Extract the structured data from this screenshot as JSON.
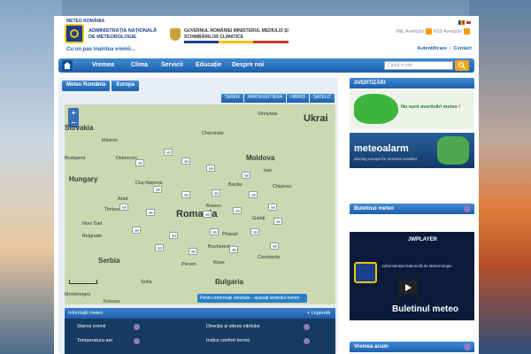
{
  "header": {
    "logo_small": "METEO ROMÂNIA",
    "anm_name": "ADMINISTRAȚIA NAȚIONALĂ DE METEOROLOGIE",
    "slogan": "Cu un pas înaintea vremii...",
    "gov_name": "GUVERNUL ROMÂNIEI MINISTERUL MEDIULUI ȘI SCHIMBĂRILOR CLIMATICE",
    "feeds": {
      "xml": "XML Avertizări",
      "rss": "RSS Avertizări"
    },
    "links": {
      "auth": "Autentificare",
      "contact": "Contact"
    }
  },
  "nav": {
    "items": [
      "Vremea",
      "Clima",
      "Servicii",
      "Educație",
      "Despre noi"
    ],
    "search_placeholder": "Caută in site"
  },
  "map": {
    "tabs": [
      "Meteo România",
      "Europa"
    ],
    "types": [
      "TEREN",
      "HARTA RUTIERA",
      "HIBRID",
      "SATELIT"
    ],
    "labels": {
      "ukraine": "Ukrai",
      "slovakia": "Slovakia",
      "hungary": "Hungary",
      "moldova": "Moldova",
      "serbia": "Serbia",
      "romania": "Romania",
      "vinnytsia": "Vinnytsia",
      "chernivtsi": "Chernivtsi",
      "miskolc": "Miskolc",
      "budapest": "Budapest",
      "debrecen": "Debrecen",
      "cluj": "Cluj-Napoca",
      "arad": "Arad",
      "timisoara": "Timisoara",
      "brasov": "Brasov",
      "bacau": "Bacău",
      "iasi": "Iasi",
      "chisinau": "Chișinau",
      "galati": "Galați",
      "ploiesti": "Ploiești",
      "bucharest": "Bucharest",
      "constanta": "Constanta",
      "novisad": "Novi Sad",
      "belgrade": "Belgrade",
      "pleven": "Pleven",
      "ruse": "Ruse",
      "sofia": "Sofia",
      "kosovo": "Kosovo",
      "montenegro": "Montenegro",
      "bulgaria": "Bulgaria"
    },
    "tip": "Pentru informații detaliate - apasați simbolul meteo"
  },
  "info": {
    "title": "Informații meteo",
    "legend": "+ Legendă",
    "items": [
      "Starea vremii",
      "Direcția și viteza vântului",
      "Temperatura aer",
      "Indice confort termic"
    ]
  },
  "sidebar": {
    "warnings_title": "AVERTIZĂRI",
    "no_warnings": "Nu sunt avertizări meteo !",
    "alarm_brand": "meteoalarm",
    "alarm_sub": "alerting europe for extreme weather",
    "bulletin_title": "Buletinul meteo",
    "player_brand": "JWPLAYER",
    "player_caption": "Administrația Națională de Meteorologie",
    "bulletin_text": "Buletinul meteo",
    "now_title": "Vremea acum"
  },
  "colors": {
    "nav_blue": "#1d5fab",
    "warn_green": "#3db53d",
    "accent_orange": "#f1a51c"
  }
}
